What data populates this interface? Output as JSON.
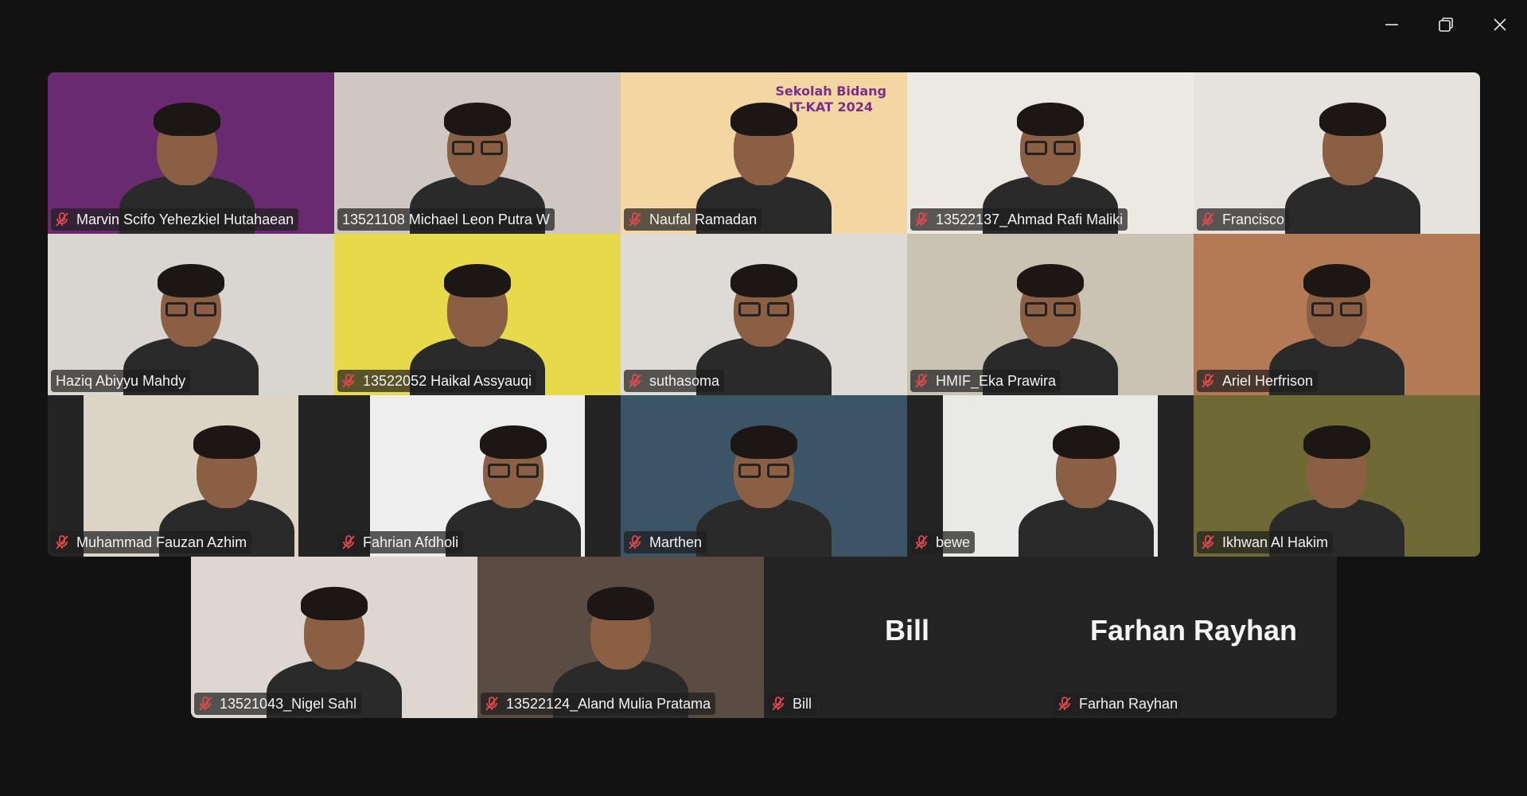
{
  "window": {
    "controls": [
      {
        "name": "minimize-icon"
      },
      {
        "name": "restore-icon"
      },
      {
        "name": "close-icon"
      }
    ]
  },
  "tiles": [
    {
      "label": "Marvin Scifo Yehezkiel Hutahaean",
      "muted": true,
      "bg": "#6a2a6f"
    },
    {
      "label": "13521108 Michael Leon Putra W",
      "muted": false,
      "active": true,
      "bg": "#cfc8c2"
    },
    {
      "label": "Naufal Ramadan",
      "muted": true,
      "bg": "#f3d6a2",
      "bg_text_1": "Sekolah Bidang",
      "bg_text_2": "IT-KAT 2024"
    },
    {
      "label": "13522137_Ahmad Rafi Maliki",
      "muted": true,
      "bg": "#ece8e2"
    },
    {
      "label": "Francisco",
      "muted": true,
      "bg": "#e6e2de"
    },
    {
      "label": "Haziq Abiyyu Mahdy",
      "muted": false,
      "bg": "#d9d6d2"
    },
    {
      "label": "13522052 Haikal Assyauqi",
      "muted": true,
      "bg": "#e8d94a"
    },
    {
      "label": "suthasoma",
      "muted": true,
      "bg": "#dedbd6"
    },
    {
      "label": "HMIF_Eka Prawira",
      "muted": true,
      "bg": "#c9c3b4"
    },
    {
      "label": "Ariel Herfrison",
      "muted": true,
      "bg": "#b37a55"
    },
    {
      "label": "Muhammad Fauzan Azhim",
      "muted": true,
      "bg": "#dcd5c6",
      "narrow": true
    },
    {
      "label": "Fahrian Afdholi",
      "muted": true,
      "bg": "#eeeeee",
      "narrow": true
    },
    {
      "label": "Marthen",
      "muted": true,
      "bg": "#3b5566"
    },
    {
      "label": "bewe",
      "muted": true,
      "bg": "#e9e9e7",
      "narrow": true
    },
    {
      "label": "Ikhwan Al Hakim",
      "muted": true,
      "bg": "#6f6a35"
    },
    {
      "label": "13521043_Nigel Sahl",
      "muted": true,
      "bg": "#ddd6d1"
    },
    {
      "label": "13522124_Aland Mulia Pratama",
      "muted": true,
      "bg": "#5a4b43"
    },
    {
      "label": "Bill",
      "muted": true,
      "no_video": true,
      "display_name": "Bill"
    },
    {
      "label": "Farhan Rayhan",
      "muted": true,
      "no_video": true,
      "display_name": "Farhan Rayhan"
    }
  ],
  "colors": {
    "active_border": "#23d18b",
    "mute_icon": "#e5484d",
    "background": "#121212"
  }
}
